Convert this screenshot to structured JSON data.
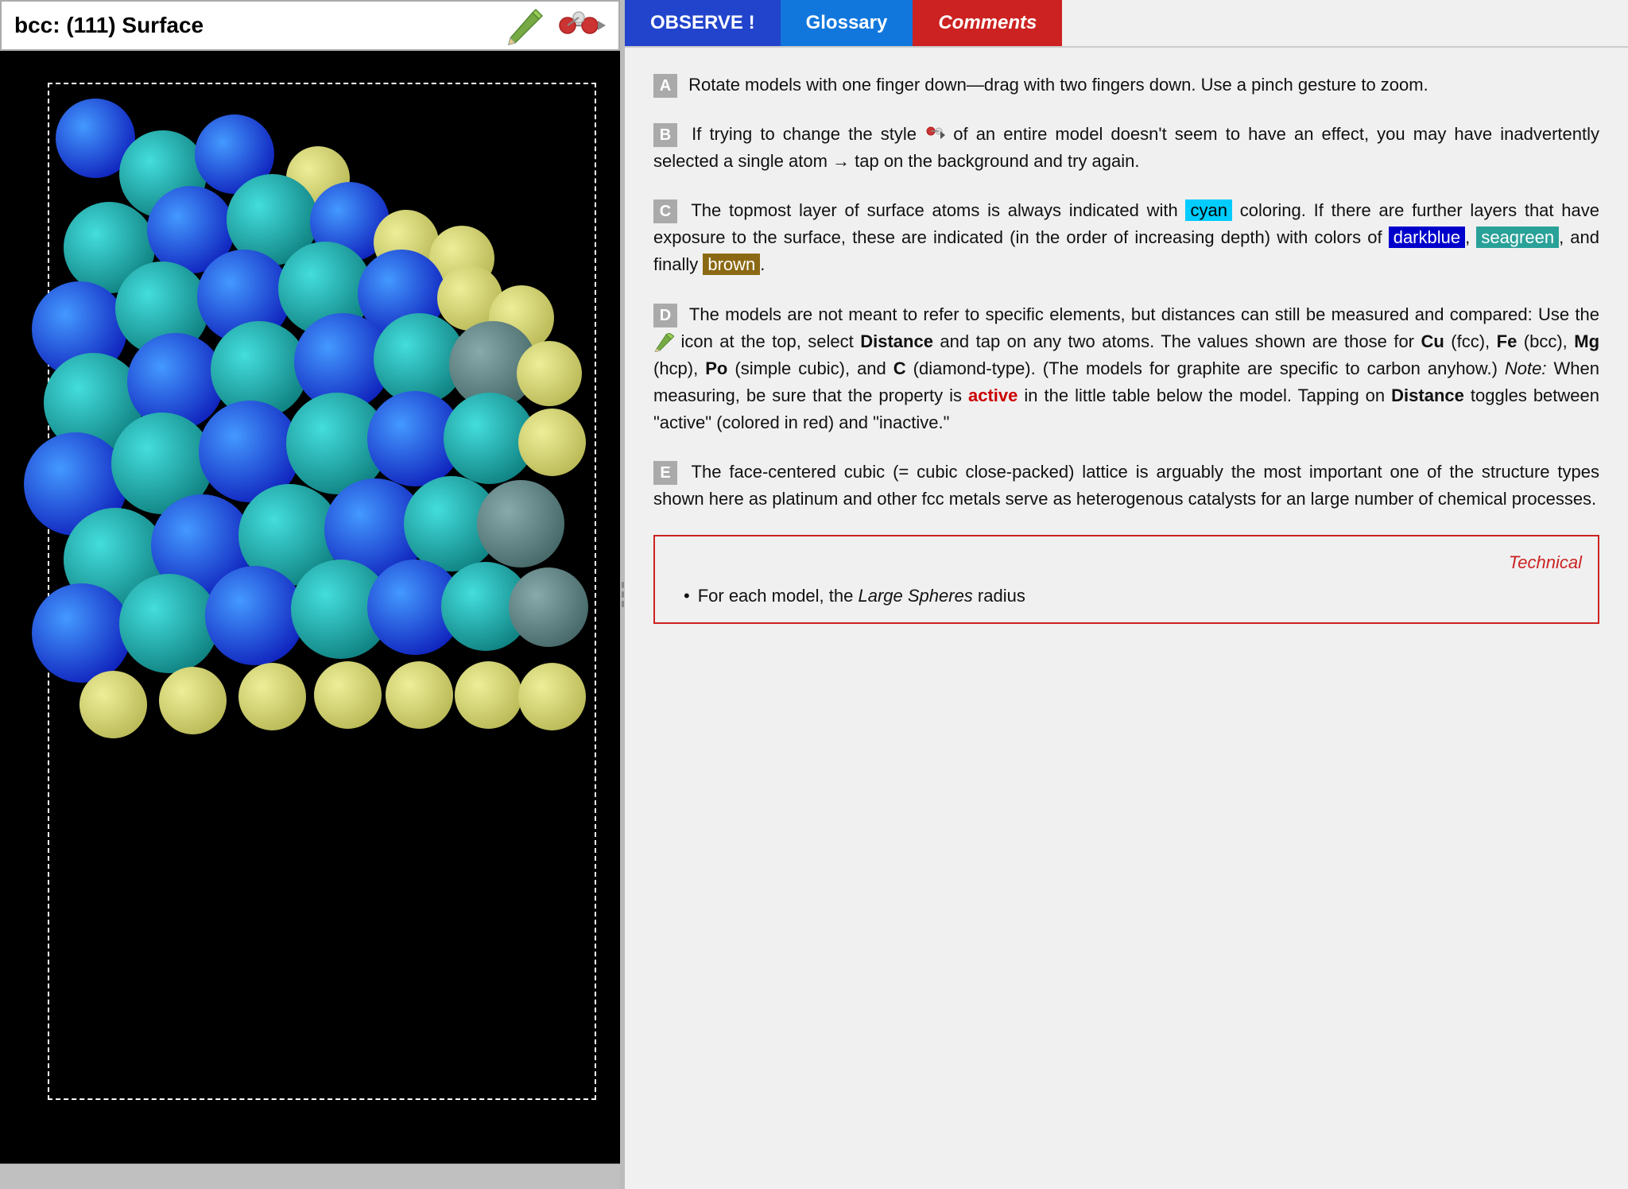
{
  "leftPanel": {
    "title": "bcc: (111) Surface",
    "resizeHandle": "|||"
  },
  "rightPanel": {
    "tabs": [
      {
        "label": "OBSERVE !",
        "id": "observe",
        "active": true
      },
      {
        "label": "Glossary",
        "id": "glossary",
        "active": false
      },
      {
        "label": "Comments",
        "id": "comments",
        "active": false
      }
    ],
    "sections": [
      {
        "id": "A",
        "text": "Rotate models with one finger down—drag with two fingers down. Use a pinch gesture to zoom."
      },
      {
        "id": "B",
        "text": "If trying to change the style  of an entire model doesn't seem to have an effect, you may have inadvertently selected a single atom → tap on the background and try again."
      },
      {
        "id": "C",
        "text": "The topmost layer of surface atoms is always indicated with  cyan  coloring. If there are further layers that have exposure to the surface, these are indicated (in the order of increasing depth) with colors of  darkblue ,  seagreen , and finally  brown ."
      },
      {
        "id": "D",
        "text": "The models are not meant to refer to specific elements, but distances can still be measured and compared: Use the  icon at the top, select Distance and tap on any two atoms. The values shown are those for Cu (fcc), Fe (bcc), Mg (hcp), Po (simple cubic), and C (diamond-type). (The models for graphite are specific to carbon anyhow.) Note: When measuring, be sure that the property is active in the little table below the model. Tapping on Distance toggles between \"active\" (colored in red) and \"inactive.\""
      },
      {
        "id": "E",
        "text": "The face-centered cubic (= cubic close-packed) lattice is arguably the most important one of the structure types shown here as platinum and other fcc metals serve as heterogenous catalysts for an large number of chemical processes."
      }
    ],
    "technical": {
      "header": "Technical",
      "bullet": "For each model, the Large Spheres radius"
    }
  }
}
